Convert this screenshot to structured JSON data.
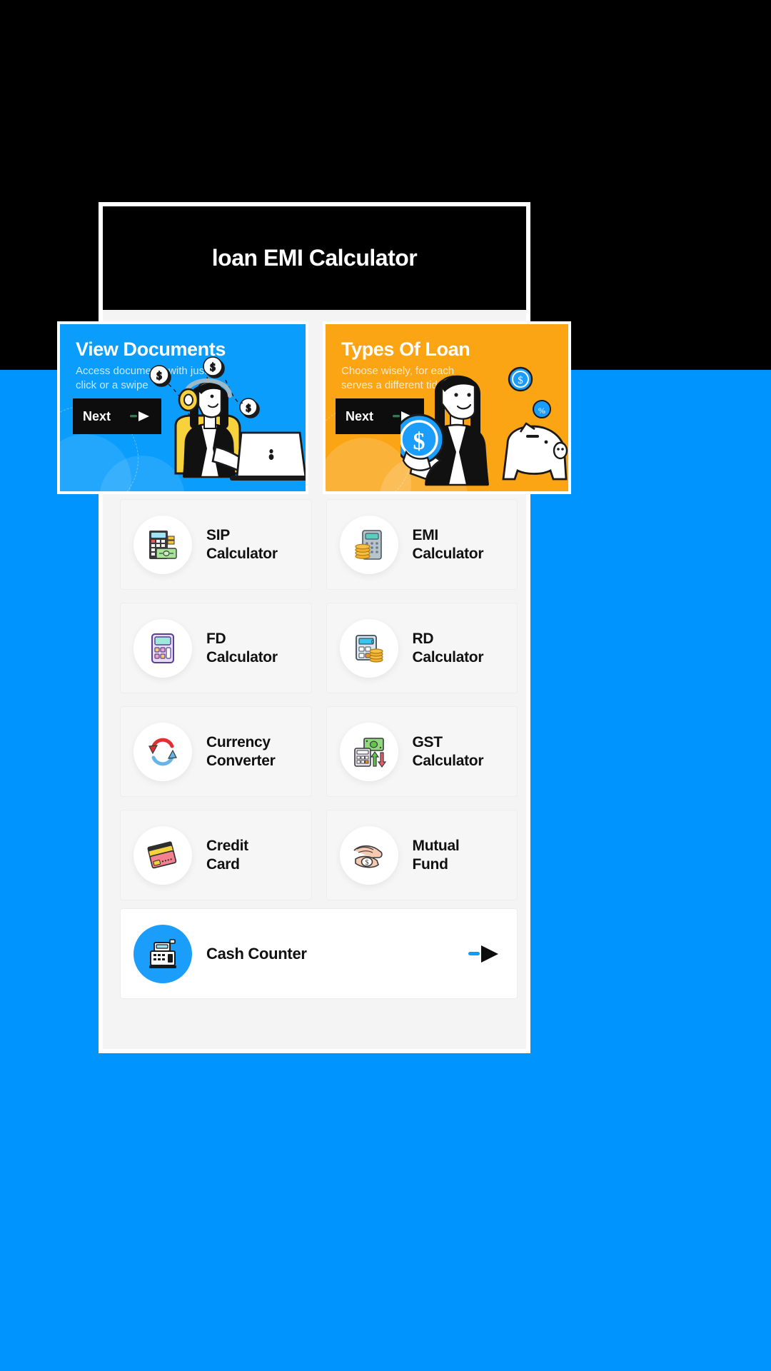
{
  "hero": {
    "title": "Loan EMI",
    "subtitle": "Calculator",
    "title_color": "#ffffff",
    "subtitle_color": "#1b9dfc",
    "background_color": "#000000"
  },
  "phone": {
    "header_title": "loan EMI Calculator",
    "header_background": "#000000",
    "body_background": "#f4f4f4"
  },
  "onboarding_cards": [
    {
      "title": "View Documents",
      "description": "Access documents with just a click or a swipe",
      "button_label": "Next",
      "background_color": "#0a9dfc",
      "illustration": "woman-with-headphones-laptop-coins"
    },
    {
      "title": "Types Of Loan",
      "description": "Choose wisely, for each serves a different tide.",
      "button_label": "Next",
      "background_color": "#fba414",
      "illustration": "woman-holding-dollar-coin-piggy-bank"
    }
  ],
  "tiles": [
    {
      "line1": "SIP",
      "line2": "Calculator",
      "icon": "calculator-cash-icon"
    },
    {
      "line1": "EMI",
      "line2": "Calculator",
      "icon": "calculator-coins-icon"
    },
    {
      "line1": "FD",
      "line2": "Calculator",
      "icon": "calculator-purple-icon"
    },
    {
      "line1": "RD",
      "line2": "Calculator",
      "icon": "calculator-coin-stack-icon"
    },
    {
      "line1": "Currency",
      "line2": "Converter",
      "icon": "currency-exchange-arrows-icon"
    },
    {
      "line1": "GST",
      "line2": "Calculator",
      "icon": "money-calculator-arrows-icon"
    },
    {
      "line1": "Credit",
      "line2": "Card",
      "icon": "credit-cards-icon"
    },
    {
      "line1": "Mutual",
      "line2": "Fund",
      "icon": "hand-coin-icon"
    }
  ],
  "cash_counter": {
    "label": "Cash Counter",
    "icon": "cash-register-icon",
    "arrow_icon": "play-arrow-icon",
    "icon_background": "#1b9dfc"
  },
  "colors": {
    "page_background": "#0094ff",
    "accent_blue": "#1b9dfc",
    "accent_orange": "#fba414",
    "black": "#000000",
    "tile_background": "#f6f6f6"
  }
}
